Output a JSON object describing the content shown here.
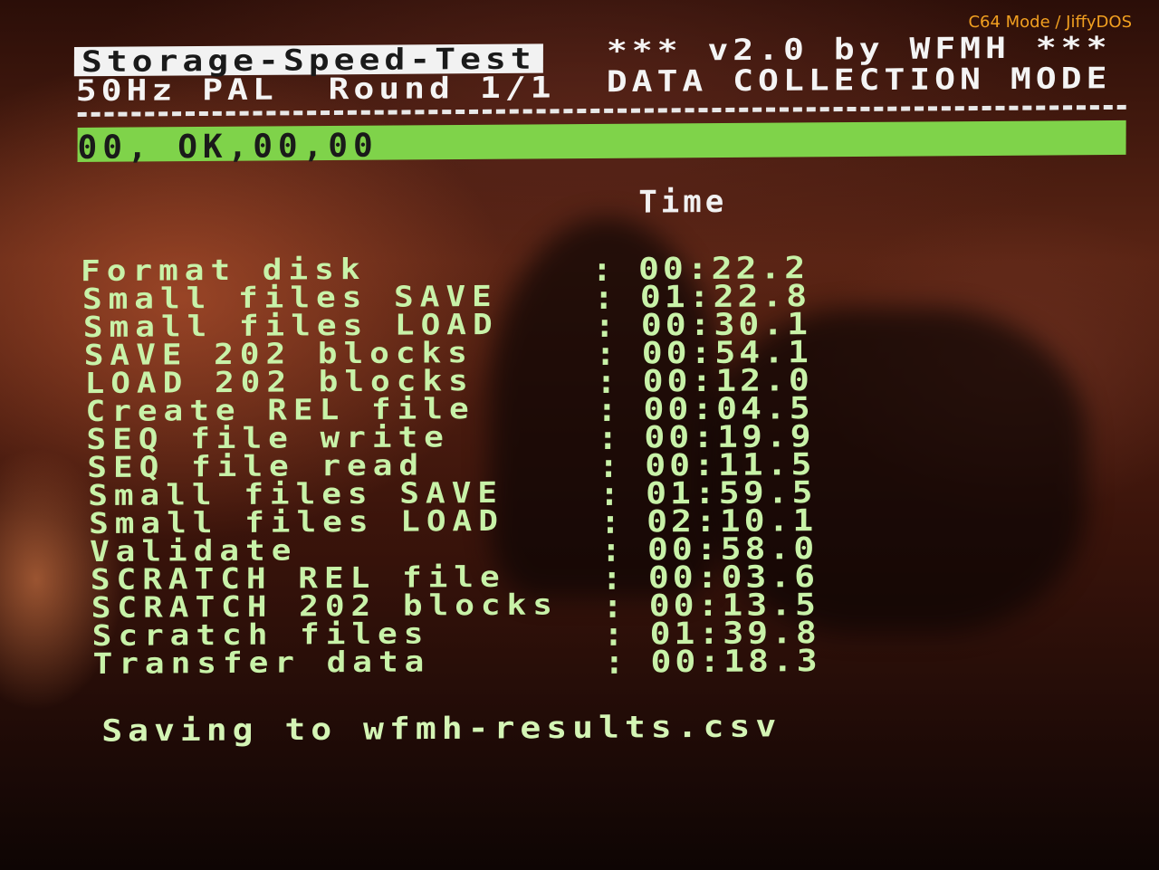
{
  "overlay": {
    "mode_label": "C64 Mode / JiffyDOS"
  },
  "header": {
    "title": "Storage-Speed-Test",
    "version": "*** v2.0 by WFMH ***",
    "video": "50Hz PAL",
    "round": "Round 1/1",
    "mode": "DATA COLLECTION MODE"
  },
  "status": {
    "text": "00, OK,00,00",
    "bar_color": "#7fd34a"
  },
  "table": {
    "time_header": "Time",
    "rows": [
      {
        "label": "Format disk",
        "time": "00:22.2"
      },
      {
        "label": "Small files SAVE",
        "time": "01:22.8"
      },
      {
        "label": "Small files LOAD",
        "time": "00:30.1"
      },
      {
        "label": "SAVE 202 blocks",
        "time": "00:54.1"
      },
      {
        "label": "LOAD 202 blocks",
        "time": "00:12.0"
      },
      {
        "label": "Create REL file",
        "time": "00:04.5"
      },
      {
        "label": "SEQ file write",
        "time": "00:19.9"
      },
      {
        "label": "SEQ file read",
        "time": "00:11.5"
      },
      {
        "label": "Small files SAVE",
        "time": "01:59.5"
      },
      {
        "label": "Small files LOAD",
        "time": "02:10.1"
      },
      {
        "label": "Validate",
        "time": "00:58.0"
      },
      {
        "label": "SCRATCH REL file",
        "time": "00:03.6"
      },
      {
        "label": "SCRATCH 202 blocks",
        "time": "00:13.5"
      },
      {
        "label": "Scratch files",
        "time": "01:39.8"
      },
      {
        "label": "Transfer data",
        "time": "00:18.3"
      }
    ]
  },
  "footer": {
    "saving": "Saving to wfmh-results.csv"
  }
}
